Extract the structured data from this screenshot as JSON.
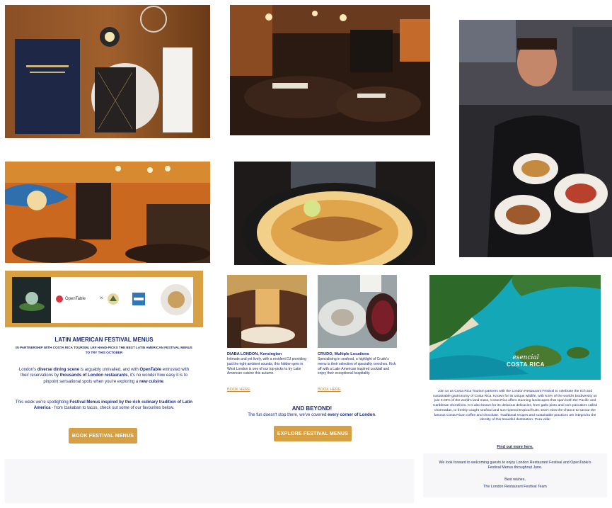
{
  "colors": {
    "gold": "#d7a043",
    "navy": "#1b2a78",
    "link": "#c58a2c"
  },
  "banner": {
    "opentable": "OpenTable",
    "times": "×"
  },
  "left": {
    "heading": "LATIN AMERICAN FESTIVAL MENUS",
    "subheading": "IN PARTNERSHIP WITH COSTA RICA TOURISM, LRF HAND-PICKS THE BEST LATIN AMERICAN FESTIVAL MENUS TO TRY THIS OCTOBER",
    "para1_a": "London's ",
    "para1_b": "diverse dining scene",
    "para1_c": " is arguably unrivalled, and with ",
    "para1_d": "OpenTable",
    "para1_e": " entrusted with their reservations by ",
    "para1_f": "thousands of London restaurants",
    "para1_g": ", it's no wonder how easy it is to pinpoint sensational spots when you're exploring a ",
    "para1_h": "new cuisine",
    "para1_i": ".",
    "para2_a": "This week we're spotlighting ",
    "para2_b": "Festival Menus inspired by the rich culinary tradition of Latin America",
    "para2_c": " - from Izakaban to tacos, check out some of our favourites below.",
    "button": "BOOK FESTIVAL MENUS"
  },
  "middle": {
    "card1_title": "DIABA LONDON, Kensington",
    "card1_text": "Intimate and yet lively, with a resident DJ providing just the right ambient sounds, this hidden gem in West London is one of our top-picks to try Latin American cuisine this autumn.",
    "card1_link": "BOOK HERE",
    "card2_title": "CRUDO, Multiple Locations",
    "card2_text": "Specialising in seafood, a highlight of Crudo's menu is their selection of speciality ceviches. Kick off with a Latin American inspired cocktail and enjoy their exceptional hospitality.",
    "card2_link": "BOOK HERE",
    "heading": "AND BEYOND!",
    "sub_a": "The fun doesn't stop there, we've covered ",
    "sub_b": "every corner of London",
    "sub_c": ".",
    "button": "EXPLORE FESTIVAL MENUS"
  },
  "right": {
    "logo_script": "esencial",
    "logo_name": "COSTA RICA",
    "para": "Join us as Costa Rica Tourism partners with the London Restaurant Festival to celebrate the rich and sustainable gastronomy of Costa Rica. Known for its unique wildlife, with 6.5% of the world's biodiversity on just 0.03% of the world's land mass, Costa Rica offers stunning landscapes that span both the Pacific and Caribbean shorelines. It is also known for its delicious delicacies, from gallo pinto and corn pancakes called chorreadas, to freshly caught seafood and sun-ripened tropical fruits. Don't miss the chance to savour the famous Costa Rican coffee and chocolate. Traditional recipes and sustainable practices are integral to the identity of this beautiful destination. Pura vida!",
    "link": "Find out more here.",
    "closing": "We look forward to welcoming guests to enjoy London Restaurant Festival and OpenTable's Festival Menus throughout June.",
    "signoff": "Best wishes,",
    "team": "The London Restaurant Festival Team"
  }
}
